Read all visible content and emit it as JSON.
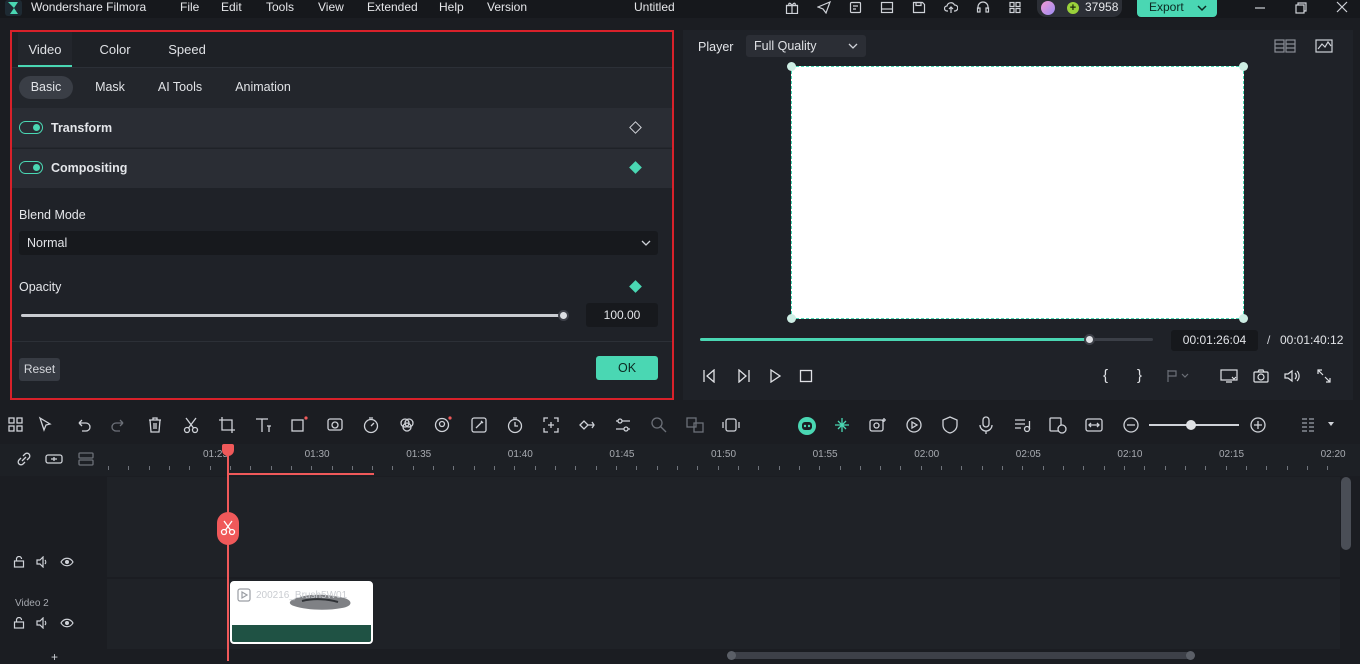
{
  "titlebar": {
    "app_name": "Wondershare Filmora",
    "menu": [
      "File",
      "Edit",
      "Tools",
      "View",
      "Extended",
      "Help",
      "Version"
    ],
    "project_title": "Untitled",
    "credits": "37958",
    "export_label": "Export"
  },
  "edit_panel": {
    "tabs": [
      "Video",
      "Color",
      "Speed"
    ],
    "active_tab": "Video",
    "subtabs": [
      "Basic",
      "Mask",
      "AI Tools",
      "Animation"
    ],
    "active_subtab": "Basic",
    "transform_label": "Transform",
    "transform_on": true,
    "compositing_label": "Compositing",
    "compositing_on": true,
    "blend_mode_label": "Blend Mode",
    "blend_mode_value": "Normal",
    "opacity_label": "Opacity",
    "opacity_value": "100.00",
    "opacity_level": 1.0,
    "reset_label": "Reset",
    "ok_label": "OK"
  },
  "player": {
    "label": "Player",
    "quality": "Full Quality",
    "current_time": "00:01:26:04",
    "separator": "/",
    "total_time": "00:01:40:12",
    "progress": 0.86
  },
  "timeline": {
    "ruler_labels": [
      "01:25",
      "01:30",
      "01:35",
      "01:40",
      "01:45",
      "01:50",
      "01:55",
      "02:00",
      "02:05",
      "02:10",
      "02:15",
      "02:20"
    ],
    "track_video2_label": "Video 2",
    "clip_name": "200216_Brush5W01",
    "add_track": "+"
  },
  "colors": {
    "accent": "#4ad7b3",
    "highlight_border": "#d8212a",
    "playhead": "#f0595a"
  }
}
